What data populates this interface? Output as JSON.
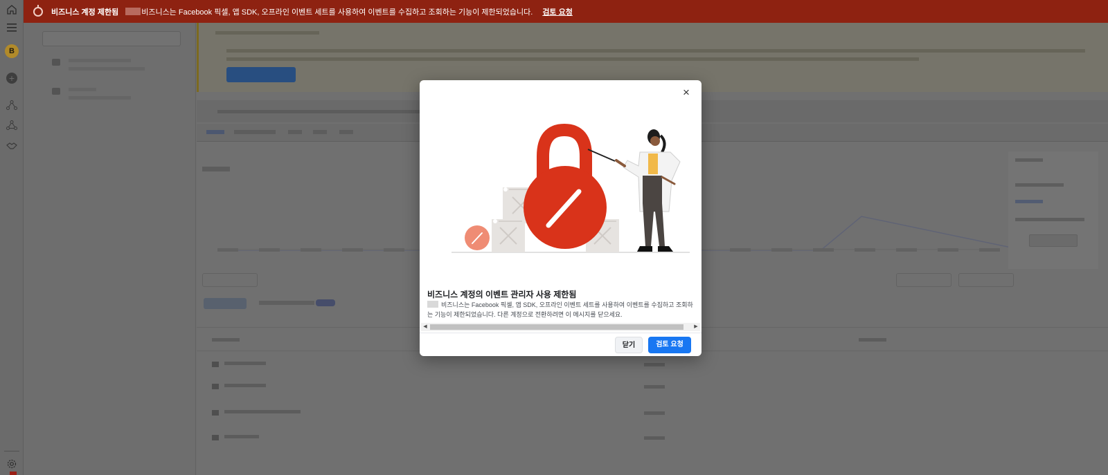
{
  "banner": {
    "title": "비즈니스 계정 제한됨",
    "message": "비즈니스는 Facebook 픽셀, 앱 SDK, 오프라인 이벤트 세트를 사용하여 이벤트를 수집하고 조회하는 기능이 제한되었습니다.",
    "link": "검토 요청",
    "bg_color": "#8e2211"
  },
  "rail": {
    "avatar_letter": "B",
    "icons": [
      "home-icon",
      "menu-icon",
      "avatar",
      "plus-icon",
      "graph-icon",
      "graph-icon-2",
      "handshake-icon",
      "settings-icon"
    ]
  },
  "modal": {
    "title": "비즈니스 계정의 이벤트 관리자 사용 제한됨",
    "body": "비즈니스는 Facebook 픽셀, 앱 SDK, 오프라인 이벤트 세트를 사용하여 이벤트를 수집하고 조회하는 기능이 제한되었습니다. 다른 계정으로 전환하려면 이 메시지를 닫으세요.",
    "close_label": "닫기",
    "primary_label": "검토 요청",
    "close_icon": "×",
    "accent_color": "#1877f2",
    "lock_color": "#d9331a"
  }
}
